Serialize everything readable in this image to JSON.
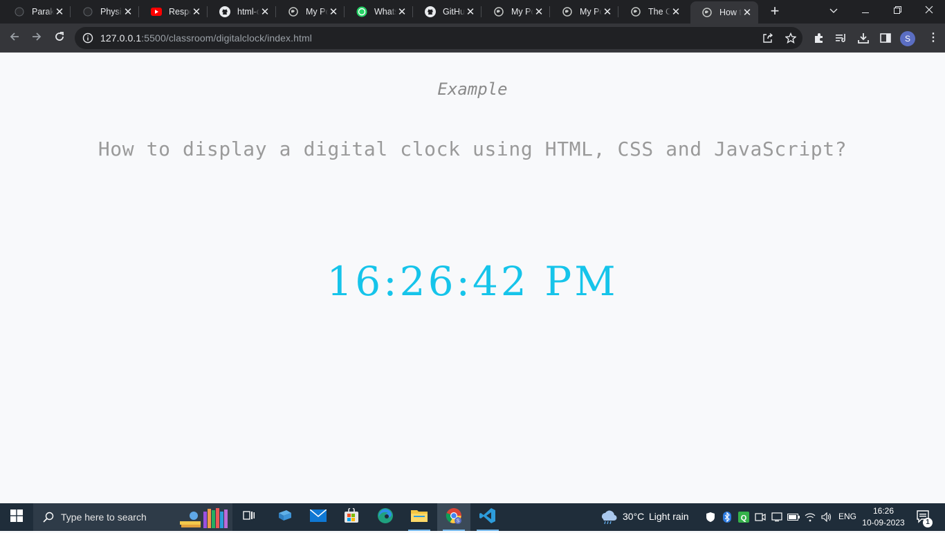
{
  "browser": {
    "tabs": [
      {
        "title": "Parakram",
        "favicon": "globe-dark-icon"
      },
      {
        "title": "Physics",
        "favicon": "globe-dark-icon"
      },
      {
        "title": "Responsive",
        "favicon": "youtube-icon"
      },
      {
        "title": "html-css",
        "favicon": "github-icon"
      },
      {
        "title": "My Portfolio",
        "favicon": "globe-icon"
      },
      {
        "title": "WhatsApp",
        "favicon": "whatsapp-icon"
      },
      {
        "title": "GitHub",
        "favicon": "github-icon"
      },
      {
        "title": "My Portfolio",
        "favicon": "globe-icon"
      },
      {
        "title": "My Portfolio",
        "favicon": "globe-icon"
      },
      {
        "title": "The Coding",
        "favicon": "globe-icon"
      },
      {
        "title": "How to",
        "favicon": "globe-icon",
        "active": true
      }
    ],
    "new_tab_label": "+",
    "url_host": "127.0.0.1",
    "url_rest": ":5500/classroom/digitalclock/index.html",
    "profile_initial": "S"
  },
  "page": {
    "example_label": "Example",
    "question": "How to display a digital clock using HTML, CSS and JavaScript?",
    "clock_time": "16:26:42 PM",
    "clock_color": "#16c4ea"
  },
  "taskbar": {
    "search_placeholder": "Type here to search",
    "weather_temp": "30°C",
    "weather_desc": "Light rain",
    "language": "ENG",
    "time": "16:26",
    "date": "10-09-2023",
    "notification_count": "1"
  }
}
